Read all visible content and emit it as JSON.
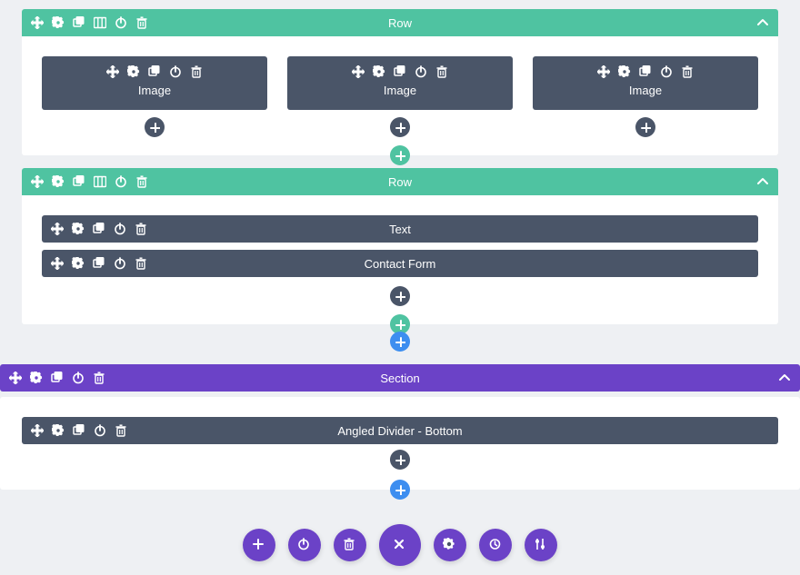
{
  "colors": {
    "row": "#4fc3a1",
    "section": "#6b42c7",
    "module": "#4a5568",
    "blue": "#3d8ef0"
  },
  "rows": [
    {
      "title": "Row",
      "layout": "three-col",
      "modules": [
        {
          "label": "Image"
        },
        {
          "label": "Image"
        },
        {
          "label": "Image"
        }
      ]
    },
    {
      "title": "Row",
      "layout": "stack",
      "modules": [
        {
          "label": "Text"
        },
        {
          "label": "Contact Form"
        }
      ]
    }
  ],
  "section": {
    "title": "Section",
    "modules": [
      {
        "label": "Angled Divider - Bottom"
      }
    ]
  },
  "icons": {
    "move": "move-icon",
    "settings": "gear-icon",
    "duplicate": "duplicate-icon",
    "columns": "columns-icon",
    "power": "power-icon",
    "delete": "trash-icon",
    "collapse": "chevron-up-icon",
    "plus": "plus-icon",
    "close": "close-icon",
    "history": "history-icon",
    "sliders": "sliders-icon"
  }
}
